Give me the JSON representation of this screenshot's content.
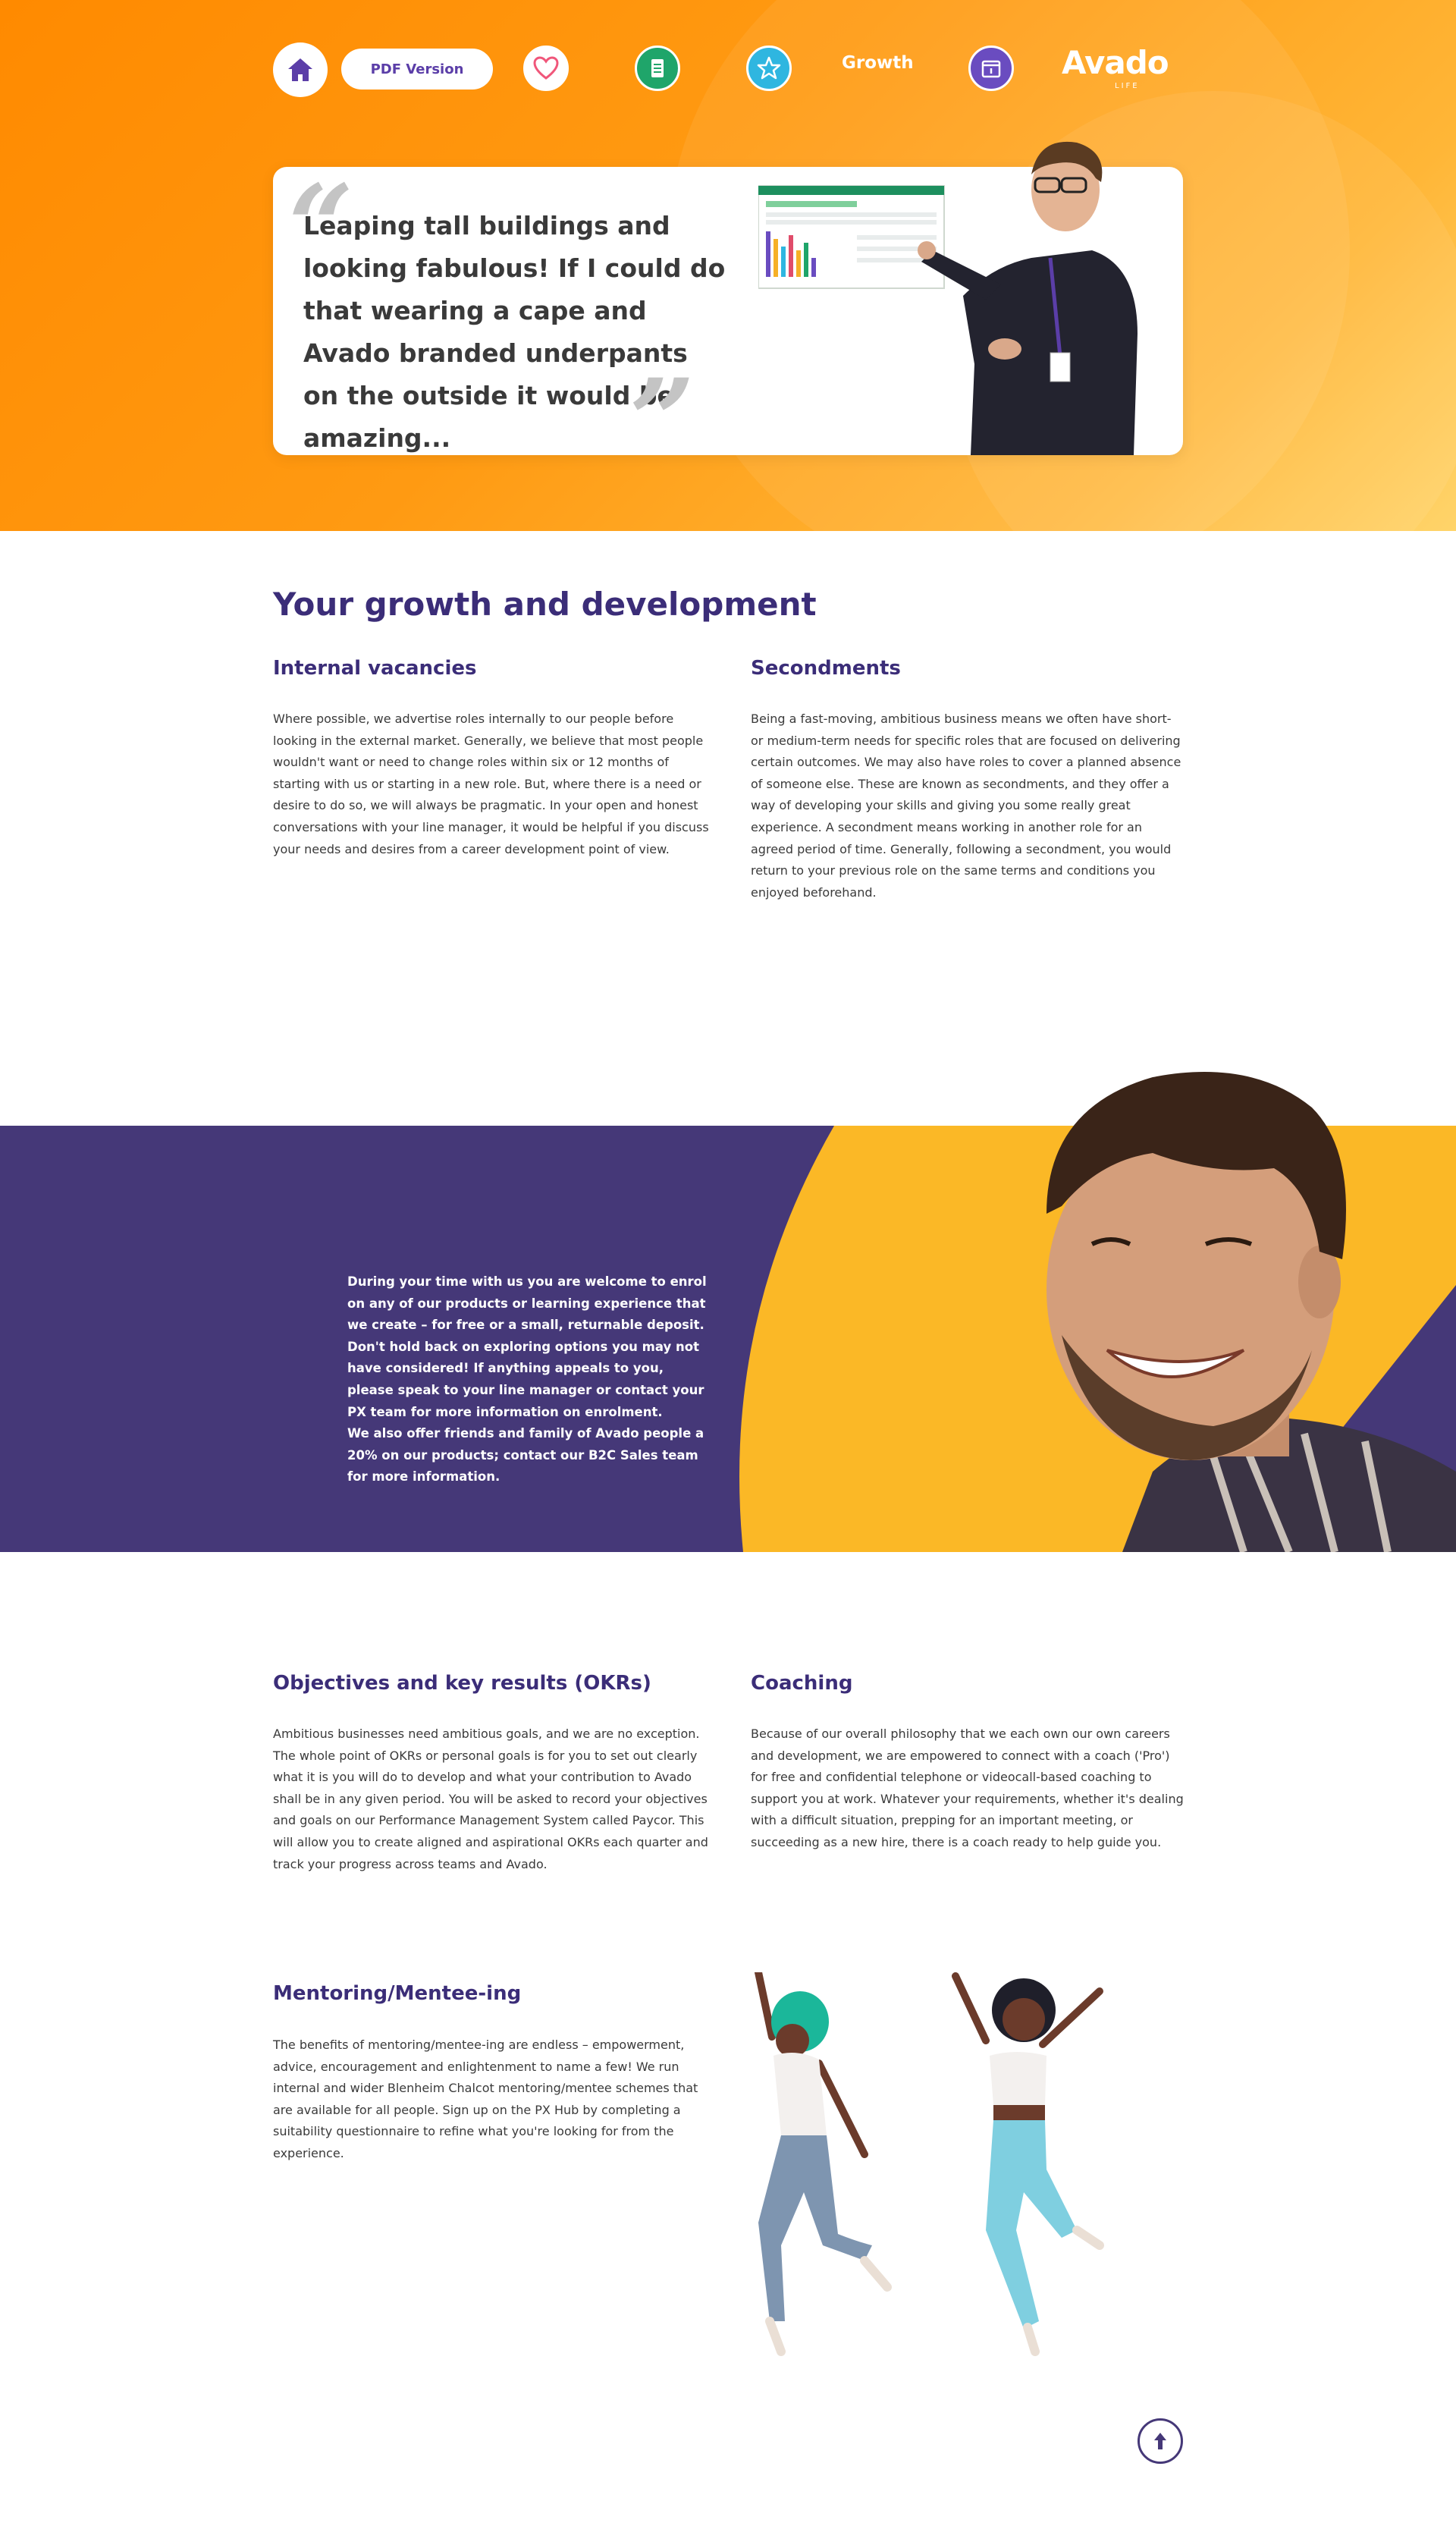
{
  "nav": {
    "home_icon": "home-icon",
    "pdf_label": "PDF Version",
    "heart_icon": "heart-icon",
    "document_icon": "document-icon",
    "star_icon": "star-icon",
    "growth_label": "Growth",
    "calendar_icon": "calendar-icon",
    "logo_text": "Avado",
    "logo_sub": "LIFE"
  },
  "hero": {
    "quote": "Leaping tall buildings and looking fabulous! If I could do that wearing a cape and Avado branded underpants on the outside it would be amazing..."
  },
  "growth": {
    "title": "Your growth and development",
    "internal_title": "Internal vacancies",
    "internal_text": "Where possible, we advertise roles internally to our people before looking in the external market. Generally, we believe that most people wouldn't want or need to change roles within six or 12 months of starting with us or starting in a new role. But, where there is a need or desire to do so, we will always be pragmatic. In your open and honest conversations with your line manager, it would be helpful if you discuss your needs and desires from a career development point of view.",
    "secondments_title": "Secondments",
    "secondments_text": "Being a fast-moving, ambitious business means we often have short- or medium-term needs for specific roles that are focused on delivering certain outcomes. We may also have roles to cover a planned absence of someone else. These are known as secondments, and they offer a way of developing your skills and giving you some really great experience. A secondment means working in another role for an agreed period of time. Generally, following a secondment, you would return to your previous role on the same terms and conditions you enjoyed beforehand."
  },
  "band": {
    "text1": "During your time with us you are welcome to enrol on any of our products or learning experience that we create – for free or a small, returnable deposit. Don't hold back on exploring options you may not have considered! If anything appeals to you, please speak to your line manager or contact your PX team for more information on enrolment.",
    "text2": "We also offer friends and family of Avado people a 20% on our products; contact our B2C Sales team for more information."
  },
  "okr": {
    "title": "Objectives and key results (OKRs)",
    "text": "Ambitious businesses need ambitious goals, and we are no exception. The whole point of OKRs or personal goals is for you to set out clearly what it is you will do to develop and what your contribution to Avado shall be in any given period. You will be asked to record your objectives and goals on our Performance Management System called Paycor. This will allow you to create aligned and aspirational OKRs each quarter and track your progress across teams and Avado."
  },
  "coaching": {
    "title": "Coaching",
    "text": "Because of our overall philosophy that we each own our own careers and development, we are empowered to connect with a coach ('Pro') for free and confidential telephone or videocall-based coaching to support you at work. Whatever your requirements, whether it's dealing with a difficult situation, prepping for an important meeting, or succeeding as a new hire, there is a coach ready to help guide you."
  },
  "mentoring": {
    "title": "Mentoring/Mentee-ing",
    "text": "The benefits of mentoring/mentee-ing are endless – empowerment, advice, encouragement and enlightenment to name a few! We run internal and wider Blenheim Chalcot mentoring/mentee schemes that are available for all people. Sign up on the PX Hub by completing a suitability questionnaire to refine what you're looking for from the experience."
  },
  "colors": {
    "orange": "#ff8a00",
    "purple": "#453878",
    "yellow": "#fbb826",
    "heading": "#3b2d78"
  },
  "back_to_top_icon": "arrow-up-icon"
}
